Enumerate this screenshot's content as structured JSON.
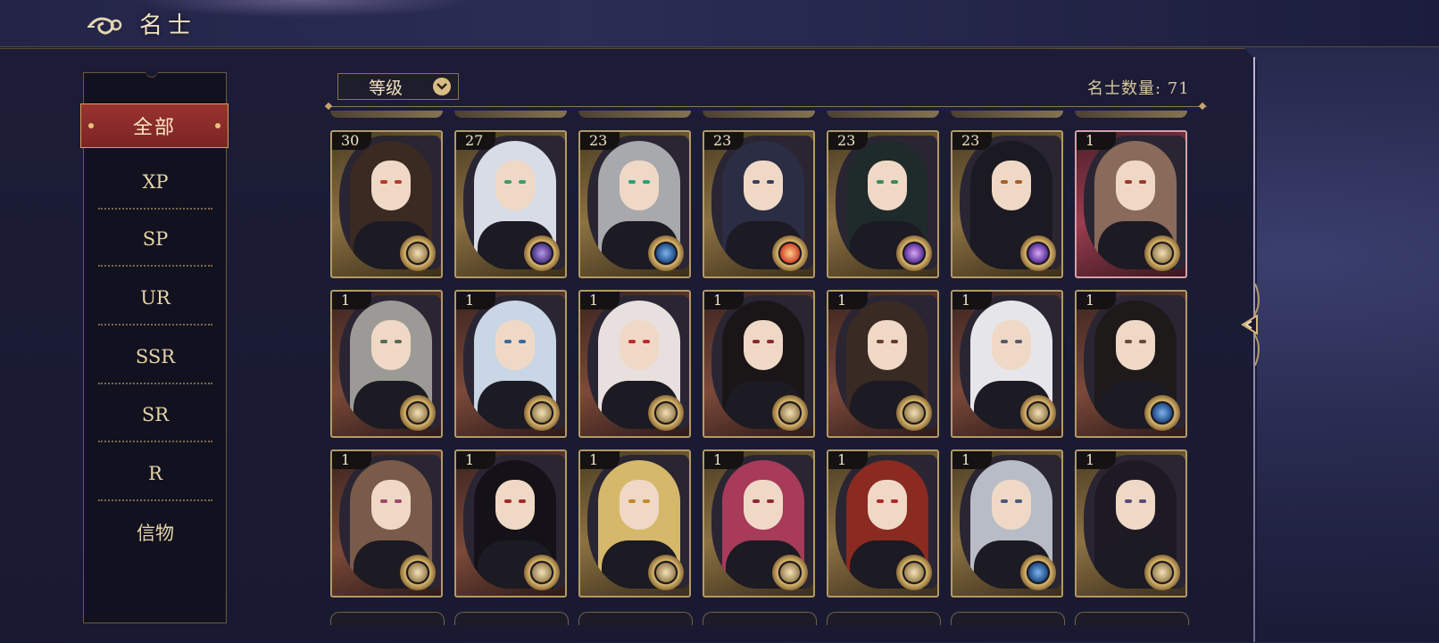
{
  "header": {
    "title": "名士"
  },
  "sidebar": {
    "tabs": [
      {
        "label": "全部",
        "active": true
      },
      {
        "label": "XP"
      },
      {
        "label": "SP"
      },
      {
        "label": "UR"
      },
      {
        "label": "SSR"
      },
      {
        "label": "SR"
      },
      {
        "label": "R"
      },
      {
        "label": "信物"
      }
    ]
  },
  "sort": {
    "selected": "等级"
  },
  "count": {
    "text": "名士数量: 71"
  },
  "colors": {
    "accent_red": "#8b2b2a",
    "gold": "#d8bd85",
    "panel": "#1c1c36"
  },
  "cards": [
    {
      "level": "30",
      "frame": "gold",
      "hair": "#3a2a22",
      "eye": "#b33a2a",
      "emblem": "gold"
    },
    {
      "level": "27",
      "frame": "gold",
      "hair": "#d8dce6",
      "eye": "#3d9b6e",
      "emblem": "purple"
    },
    {
      "level": "23",
      "frame": "gold",
      "hair": "#a8a9ad",
      "eye": "#2aa07a",
      "emblem": "blue"
    },
    {
      "level": "23",
      "frame": "gold",
      "hair": "#2b2d44",
      "eye": "#3a3f5a",
      "emblem": "orange"
    },
    {
      "level": "23",
      "frame": "gold",
      "hair": "#1f2a2a",
      "eye": "#3a8a5a",
      "emblem": "violet"
    },
    {
      "level": "23",
      "frame": "gold",
      "hair": "#1b1a22",
      "eye": "#a0612a",
      "emblem": "violet"
    },
    {
      "level": "1",
      "frame": "pink",
      "hair": "#8a6a5a",
      "eye": "#9a3a2a",
      "emblem": "gold"
    },
    {
      "level": "1",
      "frame": "copper",
      "hair": "#9c9a96",
      "eye": "#5a6a5a",
      "emblem": "gold"
    },
    {
      "level": "1",
      "frame": "copper",
      "hair": "#c8d6e6",
      "eye": "#3a6a9a",
      "emblem": "gold"
    },
    {
      "level": "1",
      "frame": "copper",
      "hair": "#e8e0de",
      "eye": "#c02a2a",
      "emblem": "gold"
    },
    {
      "level": "1",
      "frame": "copper",
      "hair": "#1a1618",
      "eye": "#8a2a2a",
      "emblem": "gold"
    },
    {
      "level": "1",
      "frame": "copper",
      "hair": "#3a2a24",
      "eye": "#6a3a2a",
      "emblem": "gold"
    },
    {
      "level": "1",
      "frame": "copper",
      "hair": "#e6e6ea",
      "eye": "#5a5a6a",
      "emblem": "gold"
    },
    {
      "level": "1",
      "frame": "copper",
      "hair": "#1e1a1a",
      "eye": "#6a4a3a",
      "emblem": "blue"
    },
    {
      "level": "1",
      "frame": "copper",
      "hair": "#7a5a48",
      "eye": "#9a4a6a",
      "emblem": "gold"
    },
    {
      "level": "1",
      "frame": "copper",
      "hair": "#141218",
      "eye": "#a02a2a",
      "emblem": "gold"
    },
    {
      "level": "1",
      "frame": "gold",
      "hair": "#d6b86a",
      "eye": "#c08a2a",
      "emblem": "gold"
    },
    {
      "level": "1",
      "frame": "gold",
      "hair": "#a83a5a",
      "eye": "#8a2a3a",
      "emblem": "gold"
    },
    {
      "level": "1",
      "frame": "gold",
      "hair": "#8a2a20",
      "eye": "#b02a2a",
      "emblem": "gold"
    },
    {
      "level": "1",
      "frame": "gold",
      "hair": "#b8bcc6",
      "eye": "#4a5a7a",
      "emblem": "blue"
    },
    {
      "level": "1",
      "frame": "gold",
      "hair": "#1e1a24",
      "eye": "#5a4a7a",
      "emblem": "gold"
    }
  ]
}
